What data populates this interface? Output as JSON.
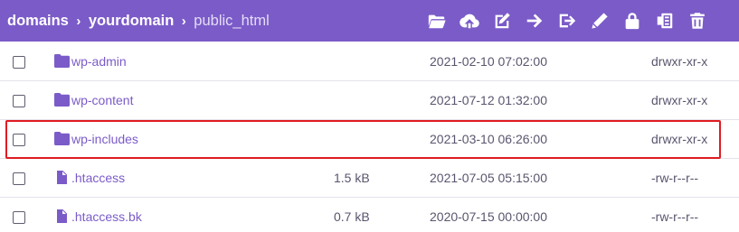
{
  "breadcrumb": {
    "items": [
      "domains",
      "yourdomain",
      "public_html"
    ],
    "separator": "›"
  },
  "toolbar": {
    "icons": [
      "folder-open-icon",
      "cloud-upload-icon",
      "edit-square-icon",
      "arrow-right-icon",
      "logout-icon",
      "pencil-icon",
      "lock-icon",
      "archive-icon",
      "trash-icon"
    ]
  },
  "files": [
    {
      "type": "folder",
      "name": "wp-admin",
      "size": "",
      "date": "2021-02-10 07:02:00",
      "perms": "drwxr-xr-x"
    },
    {
      "type": "folder",
      "name": "wp-content",
      "size": "",
      "date": "2021-07-12 01:32:00",
      "perms": "drwxr-xr-x"
    },
    {
      "type": "folder",
      "name": "wp-includes",
      "size": "",
      "date": "2021-03-10 06:26:00",
      "perms": "drwxr-xr-x"
    },
    {
      "type": "file",
      "name": ".htaccess",
      "size": "1.5 kB",
      "date": "2021-07-05 05:15:00",
      "perms": "-rw-r--r--"
    },
    {
      "type": "file",
      "name": ".htaccess.bk",
      "size": "0.7 kB",
      "date": "2020-07-15 00:00:00",
      "perms": "-rw-r--r--"
    }
  ],
  "colors": {
    "toolbar": "#7b5bc8",
    "link": "#7b5bc8",
    "highlight": "#e01b22"
  }
}
